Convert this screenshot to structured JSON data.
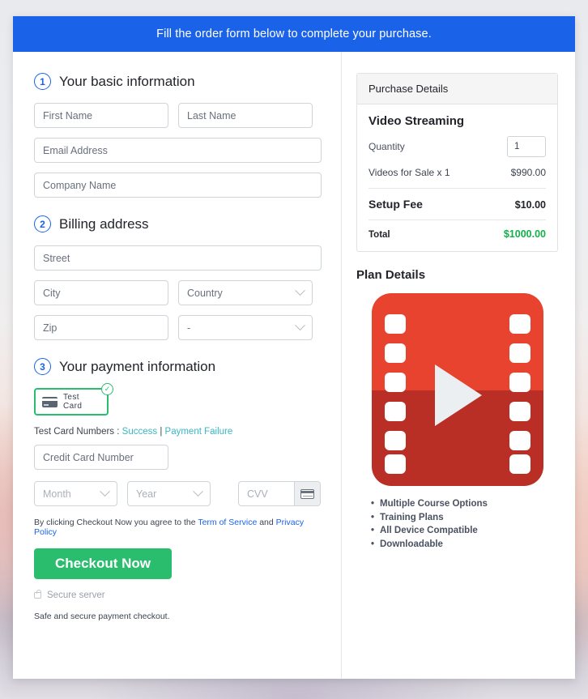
{
  "banner": {
    "text": "Fill the order form below to complete your purchase."
  },
  "sections": {
    "basic": {
      "step": "1",
      "title": "Your basic information",
      "first_name_placeholder": "First Name",
      "last_name_placeholder": "Last Name",
      "email_placeholder": "Email Address",
      "company_placeholder": "Company Name"
    },
    "billing": {
      "step": "2",
      "title": "Billing address",
      "street_placeholder": "Street",
      "city_placeholder": "City",
      "country_value": "Country",
      "zip_placeholder": "Zip",
      "state_value": "-"
    },
    "payment": {
      "step": "3",
      "title": "Your payment information",
      "method_label": "Test Card",
      "method_selected_mark": "✓",
      "test_card_prefix": "Test Card Numbers :",
      "test_card_success": "Success",
      "test_card_separator": "|",
      "test_card_failure": "Payment Failure",
      "card_number_placeholder": "Credit Card Number",
      "month_value": "Month",
      "year_value": "Year",
      "cvv_placeholder": "CVV"
    }
  },
  "terms": {
    "prefix": "By clicking Checkout Now you agree to the",
    "tos_link": "Term of Service",
    "conjunction": "and",
    "privacy_link": "Privacy Policy"
  },
  "checkout": {
    "button_label": "Checkout Now",
    "secure_label": "Secure server",
    "safe_note": "Safe and secure payment checkout."
  },
  "purchase": {
    "header": "Purchase Details",
    "product_name": "Video Streaming",
    "quantity_label": "Quantity",
    "quantity_value": "1",
    "line_item_label": "Videos for Sale x 1",
    "line_item_amount": "$990.00",
    "setup_fee_label": "Setup Fee",
    "setup_fee_amount": "$10.00",
    "total_label": "Total",
    "total_amount": "$1000.00"
  },
  "plan": {
    "title": "Plan Details",
    "features": [
      "Multiple Course Options",
      "Training Plans",
      "All Device Compatible",
      "Downloadable"
    ]
  },
  "colors": {
    "banner_blue": "#1a63e8",
    "accent_green": "#2bbd6e",
    "total_green": "#12b04a",
    "link_teal": "#3bb6c4",
    "link_blue": "#1a63e8",
    "film_red_light": "#e8432f",
    "film_red_dark": "#b92f25"
  }
}
